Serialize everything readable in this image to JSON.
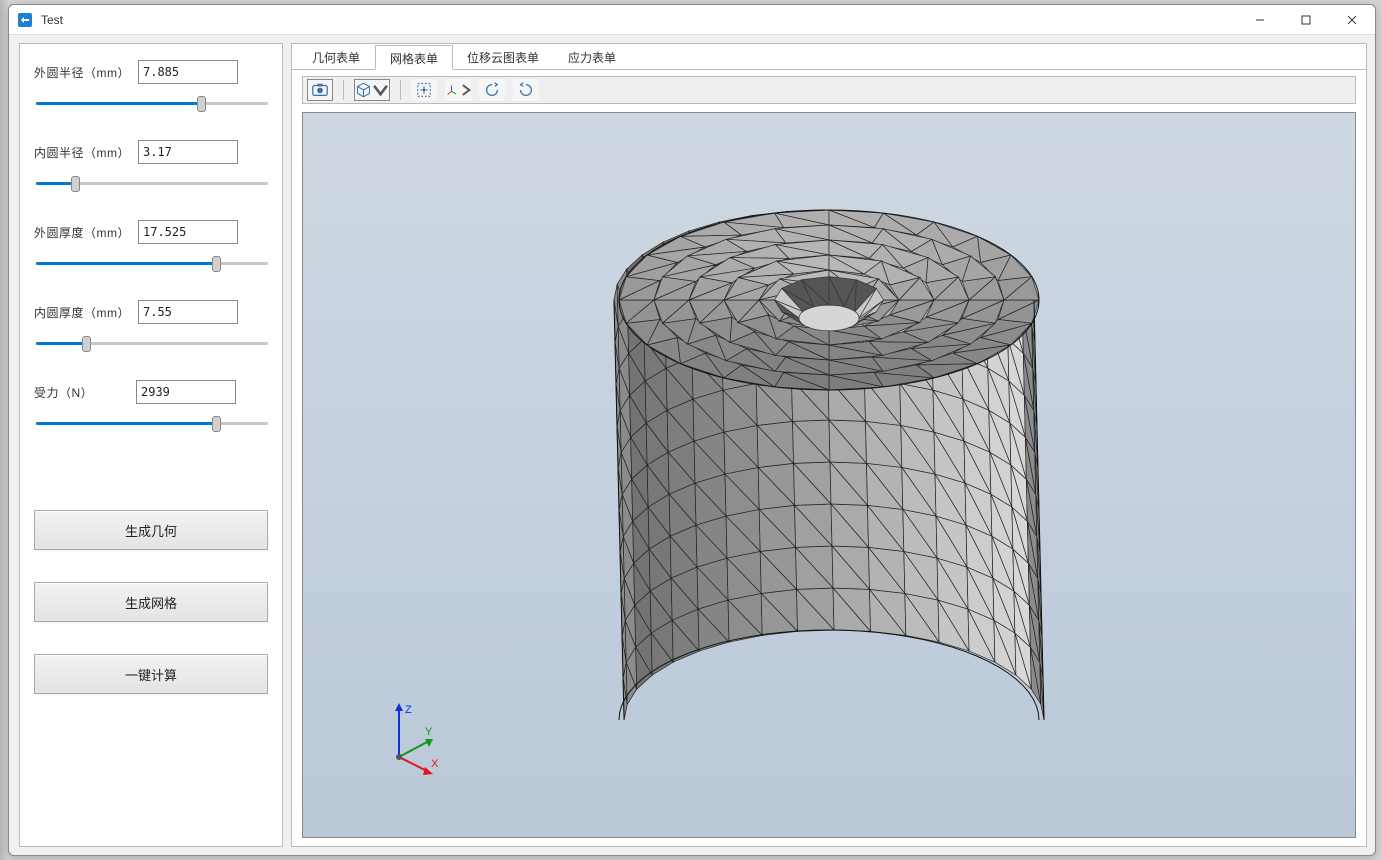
{
  "window": {
    "title": "Test"
  },
  "sidebar": {
    "fields": [
      {
        "label": "外圆半径（mm）",
        "value": "7.885",
        "pos": 92
      },
      {
        "label": "内圆半径（mm）",
        "value": "3.17",
        "pos": 22
      },
      {
        "label": "外圆厚度（mm）",
        "value": "17.525",
        "pos": 100
      },
      {
        "label": "内圆厚度（mm）",
        "value": "7.55",
        "pos": 28
      },
      {
        "label": "受力（N）",
        "value": "2939",
        "pos": 100
      }
    ],
    "buttons": {
      "gen_geometry": "生成几何",
      "gen_mesh": "生成网格",
      "compute": "一键计算"
    }
  },
  "tabs": {
    "items": [
      "几何表单",
      "网格表单",
      "位移云图表单",
      "应力表单"
    ],
    "active_index": 1
  },
  "axes": {
    "x": "X",
    "y": "Y",
    "z": "Z"
  }
}
